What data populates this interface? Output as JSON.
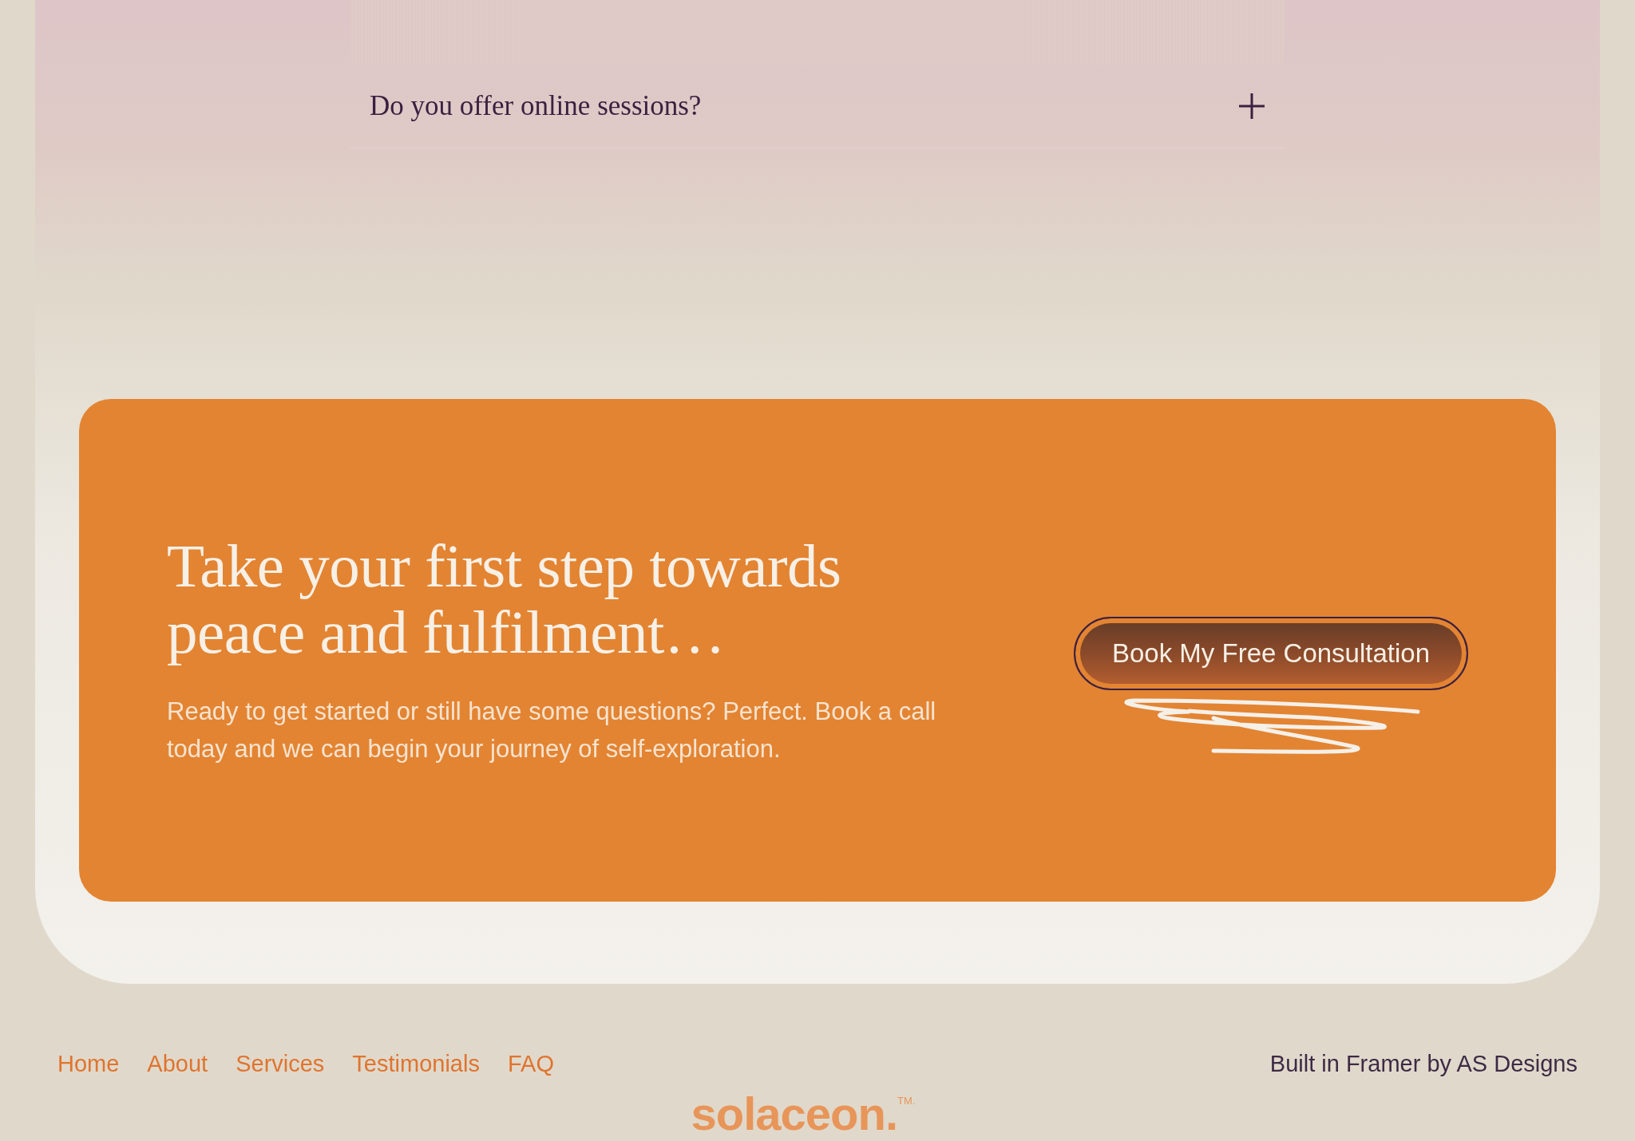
{
  "faq": [
    {
      "question": "Do you offer online sessions?",
      "expanded": false
    }
  ],
  "cta": {
    "heading": "Take your first step towards peace and fulfilment…",
    "text": "Ready to get started or still have some questions? Perfect. Book a call today and we can begin your journey of self-exploration.",
    "button": "Book My Free Consultation"
  },
  "footer": {
    "links": [
      "Home",
      "About",
      "Services",
      "Testimonials",
      "FAQ"
    ],
    "credit": "Built in Framer by AS Designs",
    "logo": "solaceon.$^{TM.}$"
  }
}
